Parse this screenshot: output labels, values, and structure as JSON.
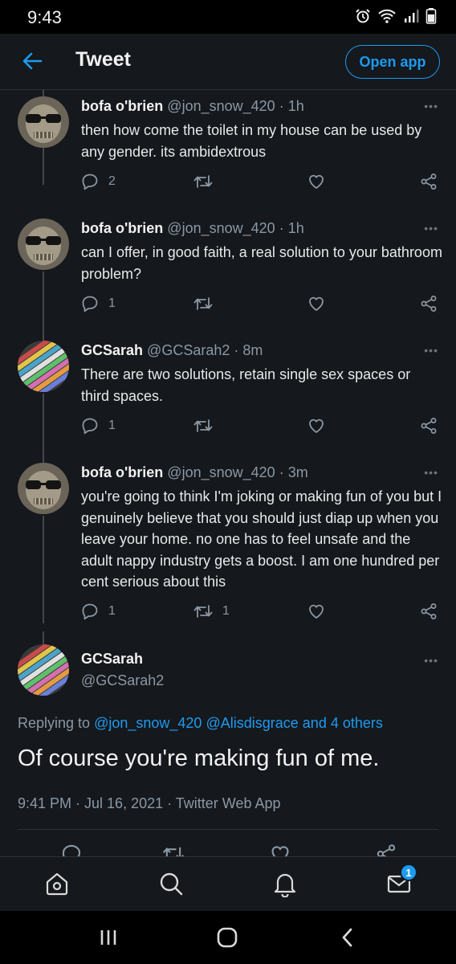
{
  "status": {
    "time": "9:43"
  },
  "appbar": {
    "title": "Tweet",
    "open_app": "Open app"
  },
  "tweets": [
    {
      "name": "bofa o'brien",
      "handle": "@jon_snow_420",
      "age": "1h",
      "avatar": "skull",
      "text": "then how come the toilet in my house can be used by any gender. its ambidextrous",
      "replies": "2",
      "retweets": "",
      "likes": ""
    },
    {
      "name": "bofa o'brien",
      "handle": "@jon_snow_420",
      "age": "1h",
      "avatar": "skull",
      "text": "can I offer, in good faith, a real solution to your bathroom problem?",
      "replies": "1",
      "retweets": "",
      "likes": ""
    },
    {
      "name": "GCSarah",
      "handle": "@GCSarah2",
      "age": "8m",
      "avatar": "beads",
      "text": "There are two solutions, retain single sex spaces or third spaces.",
      "replies": "1",
      "retweets": "",
      "likes": ""
    },
    {
      "name": "bofa o'brien",
      "handle": "@jon_snow_420",
      "age": "3m",
      "avatar": "skull",
      "text": "you're going to think I'm joking or making fun of you but I genuinely believe that you should just diap up when you leave your home. no one has to feel unsafe and the adult nappy industry gets a boost. I am one hundred per cent serious about this",
      "replies": "1",
      "retweets": "1",
      "likes": ""
    }
  ],
  "focal": {
    "name": "GCSarah",
    "handle": "@GCSarah2",
    "replying_prefix": "Replying to",
    "replying_to_1": "@jon_snow_420",
    "replying_to_2": "@Alisdisgrace",
    "replying_others": "and 4 others",
    "text": "Of course you're making fun of me.",
    "meta": "9:41 PM · Jul 16, 2021 · Twitter Web App"
  },
  "nav": {
    "messages_badge": "1"
  },
  "colors": {
    "accent": "#1d9bf0",
    "background": "#15181c",
    "text": "#e7e9ea",
    "muted": "#8b98a5"
  },
  "icons": [
    "back-arrow-icon",
    "reply-icon",
    "retweet-icon",
    "like-icon",
    "share-icon",
    "home-icon",
    "search-icon",
    "notifications-icon",
    "messages-icon"
  ]
}
